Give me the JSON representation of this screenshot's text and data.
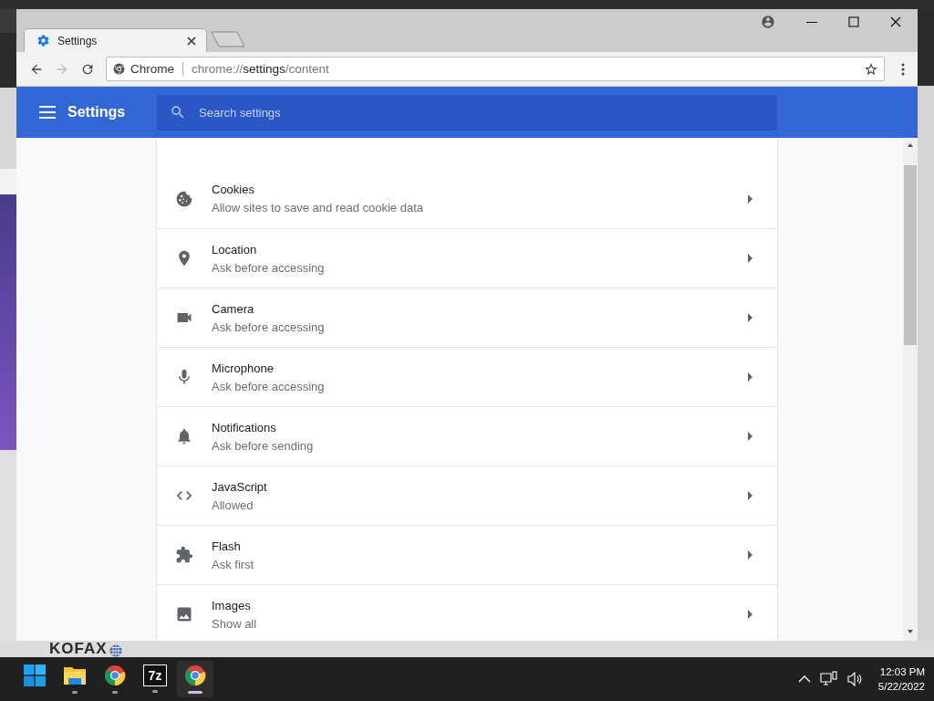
{
  "browser": {
    "tabs": [
      {
        "title": "Settings",
        "selected": true
      }
    ],
    "omnibox": {
      "site_label": "Chrome",
      "url_scheme": "chrome://",
      "url_host": "settings",
      "url_path": "/content"
    }
  },
  "settings": {
    "title": "Settings",
    "search_placeholder": "Search settings",
    "items": [
      {
        "kind": "cookies",
        "title": "Cookies",
        "subtitle": "Allow sites to save and read cookie data"
      },
      {
        "kind": "location",
        "title": "Location",
        "subtitle": "Ask before accessing"
      },
      {
        "kind": "camera",
        "title": "Camera",
        "subtitle": "Ask before accessing"
      },
      {
        "kind": "microphone",
        "title": "Microphone",
        "subtitle": "Ask before accessing"
      },
      {
        "kind": "notifications",
        "title": "Notifications",
        "subtitle": "Ask before sending"
      },
      {
        "kind": "javascript",
        "title": "JavaScript",
        "subtitle": "Allowed"
      },
      {
        "kind": "flash",
        "title": "Flash",
        "subtitle": "Ask first"
      },
      {
        "kind": "images",
        "title": "Images",
        "subtitle": "Show all"
      }
    ]
  },
  "backdrop": {
    "logo": "KOFAX"
  },
  "taskbar": {
    "apps": [
      {
        "kind": "start",
        "running": false,
        "selected": false
      },
      {
        "kind": "files",
        "running": true,
        "selected": false
      },
      {
        "kind": "chrome",
        "running": true,
        "selected": false
      },
      {
        "kind": "archiver",
        "label": "7z",
        "running": true,
        "selected": false
      },
      {
        "kind": "chrome",
        "running": true,
        "selected": true
      }
    ],
    "time": "12:03 PM",
    "date": "5/22/2022"
  }
}
